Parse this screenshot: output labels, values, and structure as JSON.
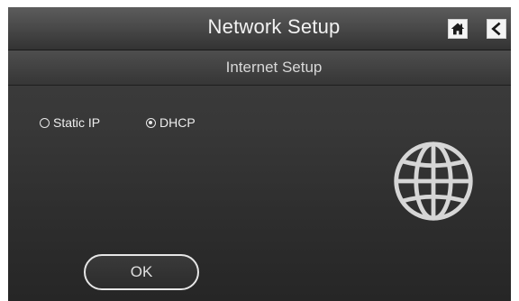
{
  "header": {
    "title": "Network Setup",
    "home_icon": "home-icon",
    "back_icon": "back-arrow-icon"
  },
  "subheader": {
    "title": "Internet Setup"
  },
  "connection_type": {
    "options": [
      {
        "label": "Static IP",
        "selected": false
      },
      {
        "label": "DHCP",
        "selected": true
      }
    ]
  },
  "illustration": {
    "icon": "globe-icon"
  },
  "footer": {
    "ok_label": "OK"
  },
  "colors": {
    "background": "#333333",
    "title_bar": "#4a4a4a",
    "text": "#f2f2f2",
    "icon_button_bg": "#f4f4f4",
    "icon_button_glyph": "#1a1a1a",
    "globe_stroke": "#d6d6d6"
  }
}
